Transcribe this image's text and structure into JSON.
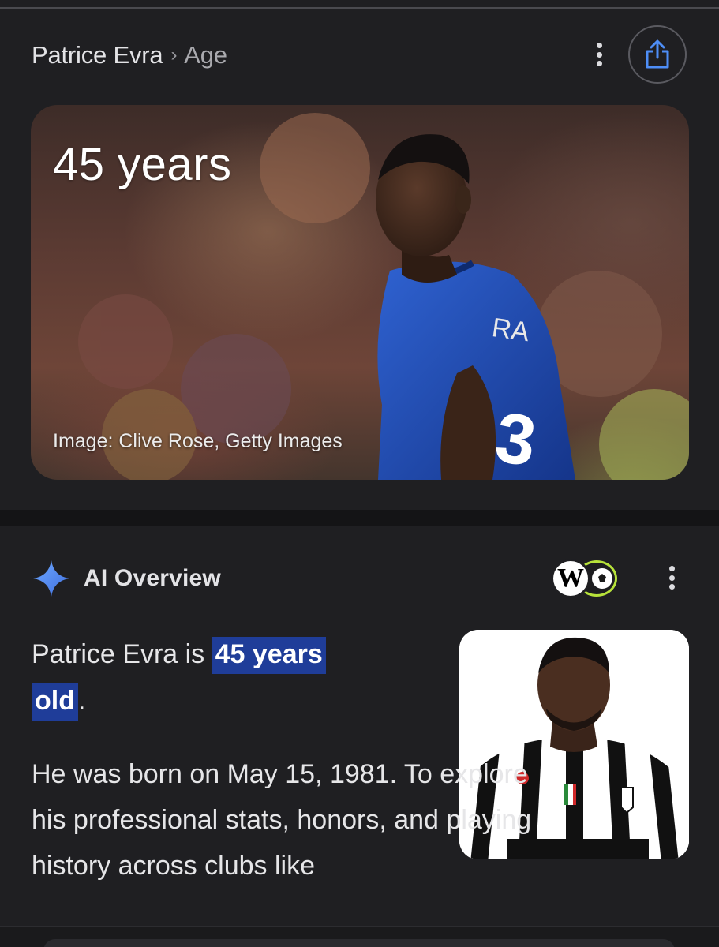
{
  "header": {
    "title": "Patrice Evra",
    "separator": "›",
    "subtitle": "Age"
  },
  "icons": {
    "more_options": "kebab-vertical-icon",
    "share": "share-icon",
    "ai_spark": "sparkle-icon",
    "source_wikipedia": "wikipedia-icon",
    "source_soccer": "soccer-ball-icon"
  },
  "hero": {
    "age_text": "45 years",
    "credit": "Image: Clive Rose, Getty Images"
  },
  "ai_overview": {
    "title": "AI Overview",
    "wiki_letter": "W",
    "answer_prefix": "Patrice Evra is ",
    "answer_highlight_1": "45 years",
    "answer_highlight_2": "old",
    "answer_suffix": ".",
    "detail": "He was born on May 15, 1981. To explore his professional stats, honors, and playing history across clubs like"
  },
  "colors": {
    "background": "#1f1f22",
    "highlight": "#1f3d99",
    "ai_spark": "#4d8bf5",
    "jersey_france": "#1f4fb3"
  }
}
